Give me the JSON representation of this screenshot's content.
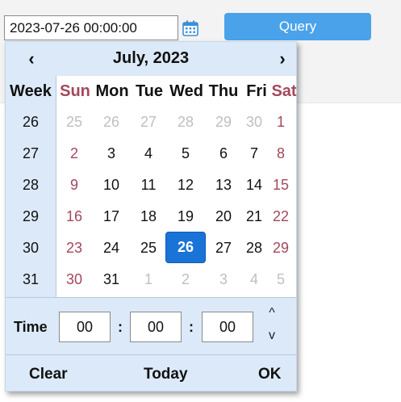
{
  "input": {
    "value": "2023-07-26 00:00:00"
  },
  "query_button": {
    "label": "Query"
  },
  "picker": {
    "prev_label": "‹",
    "next_label": "›",
    "month_title": "July, 2023",
    "week_header": "Week",
    "day_headers": [
      "Sun",
      "Mon",
      "Tue",
      "Wed",
      "Thu",
      "Fri",
      "Sat"
    ],
    "weeks": [
      {
        "num": "26",
        "days": [
          "25",
          "26",
          "27",
          "28",
          "29",
          "30",
          "1"
        ]
      },
      {
        "num": "27",
        "days": [
          "2",
          "3",
          "4",
          "5",
          "6",
          "7",
          "8"
        ]
      },
      {
        "num": "28",
        "days": [
          "9",
          "10",
          "11",
          "12",
          "13",
          "14",
          "15"
        ]
      },
      {
        "num": "29",
        "days": [
          "16",
          "17",
          "18",
          "19",
          "20",
          "21",
          "22"
        ]
      },
      {
        "num": "30",
        "days": [
          "23",
          "24",
          "25",
          "26",
          "27",
          "28",
          "29"
        ]
      },
      {
        "num": "31",
        "days": [
          "30",
          "31",
          "1",
          "2",
          "3",
          "4",
          "5"
        ]
      }
    ],
    "other_month": [
      [
        true,
        true,
        true,
        true,
        true,
        true,
        false
      ],
      [
        false,
        false,
        false,
        false,
        false,
        false,
        false
      ],
      [
        false,
        false,
        false,
        false,
        false,
        false,
        false
      ],
      [
        false,
        false,
        false,
        false,
        false,
        false,
        false
      ],
      [
        false,
        false,
        false,
        false,
        false,
        false,
        false
      ],
      [
        false,
        false,
        true,
        true,
        true,
        true,
        true
      ]
    ],
    "selected": {
      "week": 4,
      "day": 3,
      "label": "26"
    },
    "time": {
      "label": "Time",
      "hours": "00",
      "minutes": "00",
      "seconds": "00",
      "separator": ":",
      "up": "^",
      "down": "v"
    },
    "footer": {
      "clear": "Clear",
      "today": "Today",
      "ok": "OK"
    }
  },
  "colors": {
    "accent": "#4aa3ea",
    "selected": "#1a73d6",
    "weekend": "#a3485c",
    "picker_bg": "#dce9f8"
  }
}
